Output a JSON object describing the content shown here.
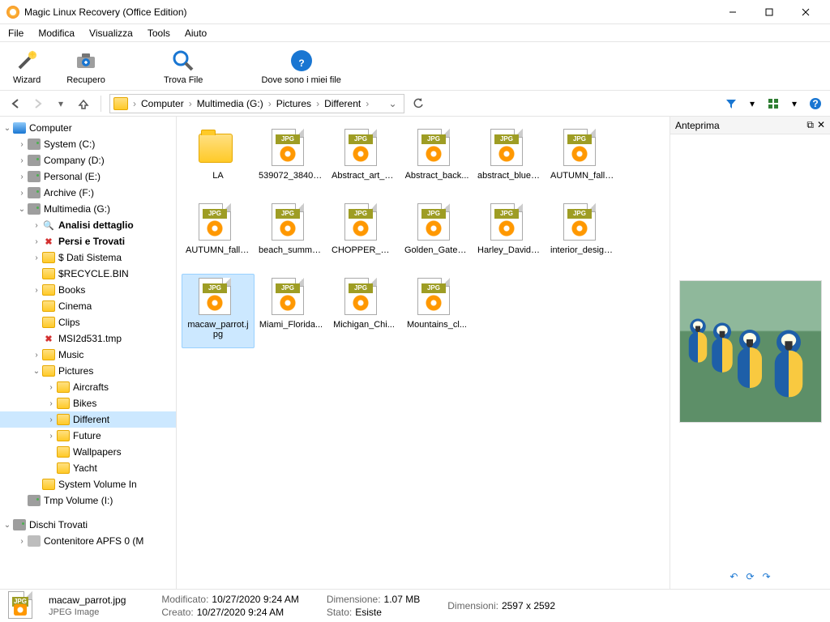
{
  "window": {
    "title": "Magic Linux Recovery (Office Edition)"
  },
  "menu": {
    "file": "File",
    "edit": "Modifica",
    "view": "Visualizza",
    "tools": "Tools",
    "help": "Aiuto"
  },
  "toolbar": {
    "wizard": "Wizard",
    "recovery": "Recupero",
    "find": "Trova File",
    "where": "Dove sono i miei file"
  },
  "breadcrumb": {
    "items": [
      "Computer",
      "Multimedia (G:)",
      "Pictures",
      "Different"
    ]
  },
  "tree": {
    "root": "Computer",
    "drives": {
      "c": "System (C:)",
      "d": "Company (D:)",
      "e": "Personal (E:)",
      "f": "Archive (F:)",
      "g": "Multimedia (G:)",
      "i": "Tmp Volume (I:)"
    },
    "g_children": {
      "analisi": "Analisi dettaglio",
      "persi": "Persi e Trovati",
      "dati": "$ Dati Sistema",
      "recycle": "$RECYCLE.BIN",
      "books": "Books",
      "cinema": "Cinema",
      "clips": "Clips",
      "tmp": "MSI2d531.tmp",
      "music": "Music",
      "pictures": "Pictures",
      "sysvol": "System Volume In"
    },
    "pictures_children": {
      "aircrafts": "Aircrafts",
      "bikes": "Bikes",
      "different": "Different",
      "future": "Future",
      "wallpapers": "Wallpapers",
      "yacht": "Yacht"
    },
    "found": "Dischi Trovati",
    "apfs": "Contenitore APFS 0 (M"
  },
  "files": {
    "jpg_tag": "JPG",
    "folder_la": "LA",
    "f0": "539072_3840x...",
    "f1": "Abstract_art_b...",
    "f2": "Abstract_back...",
    "f3": "abstract_blue_...",
    "f4": "AUTUMN_fall_...",
    "f5": "AUTUMN_fall_...",
    "f6": "beach_summe...",
    "f7": "CHOPPER_mo...",
    "f8": "Golden_Gate_f...",
    "f9": "Harley_Davids...",
    "f10": "interior_design...",
    "selected": "macaw_parrot.jpg",
    "f11": "Miami_Florida...",
    "f12": "Michigan_Chi...",
    "f13": "Mountains_cl..."
  },
  "preview": {
    "header": "Anteprima"
  },
  "status": {
    "filename": "macaw_parrot.jpg",
    "filetype": "JPEG Image",
    "modified_k": "Modificato:",
    "modified_v": "10/27/2020 9:24 AM",
    "created_k": "Creato:",
    "created_v": "10/27/2020 9:24 AM",
    "size_k": "Dimensione:",
    "size_v": "1.07 MB",
    "state_k": "Stato:",
    "state_v": "Esiste",
    "dims_k": "Dimensioni:",
    "dims_v": "2597 x 2592"
  }
}
